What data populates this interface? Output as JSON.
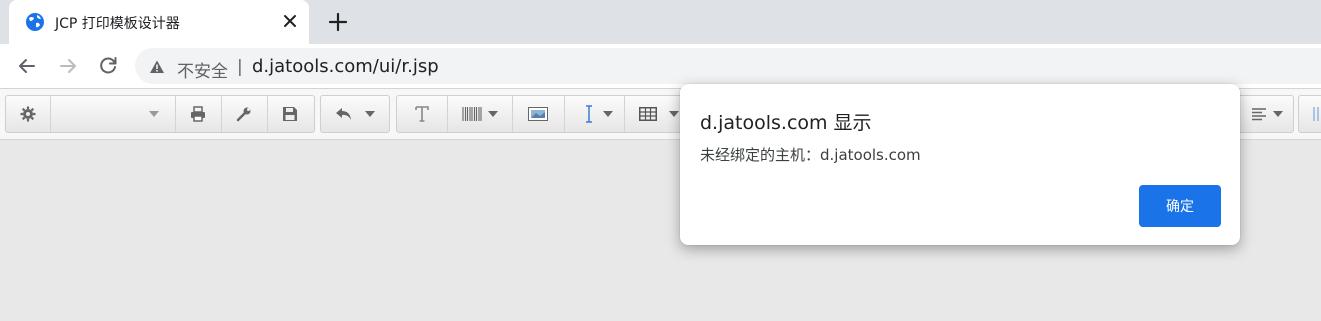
{
  "tab": {
    "title": "JCP 打印模板设计器",
    "favicon": "globe-icon"
  },
  "omnibox": {
    "security_label": "不安全",
    "separator": "|",
    "url": "d.jatools.com/ui/r.jsp"
  },
  "toolbar": {
    "icons": [
      "gear-icon",
      "dropdown-select",
      "print-icon",
      "wrench-icon",
      "save-icon",
      "undo-icon",
      "text-icon",
      "barcode-icon",
      "image-icon",
      "line-icon",
      "table-icon",
      "align-icon"
    ]
  },
  "dialog": {
    "title": "d.jatools.com 显示",
    "message": "未经绑定的主机：d.jatools.com",
    "ok_label": "确定"
  },
  "colors": {
    "accent": "#1a73e8",
    "tabstrip": "#dee1e6",
    "canvas": "#e8e8e8"
  }
}
